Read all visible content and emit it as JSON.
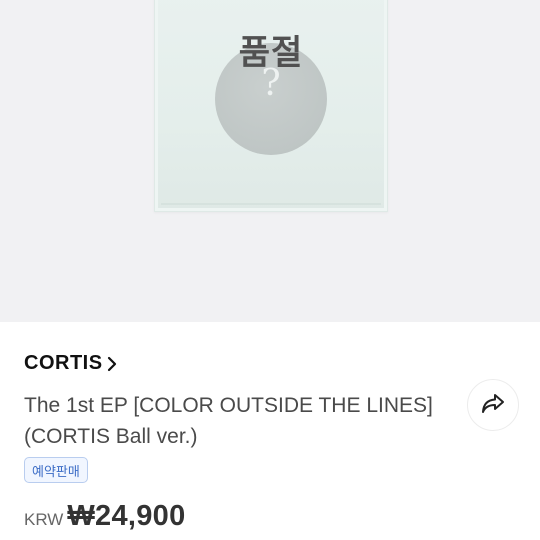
{
  "product_image": {
    "overlay_text": "품절",
    "disc_symbol": "?"
  },
  "product": {
    "brand": "CORTIS",
    "title_line1": "The 1st EP [COLOR OUTSIDE THE LINES]",
    "title_line2": "(CORTIS Ball ver.)",
    "badge": "예약판매",
    "currency": "KRW",
    "price": "₩24,900"
  },
  "icons": {
    "brand_link": "chevron-right-icon",
    "share": "share-arrow-icon"
  },
  "colors": {
    "badge_text": "#3c6dc6",
    "badge_border": "#b9cdef",
    "album_background": "#e4eeeb"
  }
}
